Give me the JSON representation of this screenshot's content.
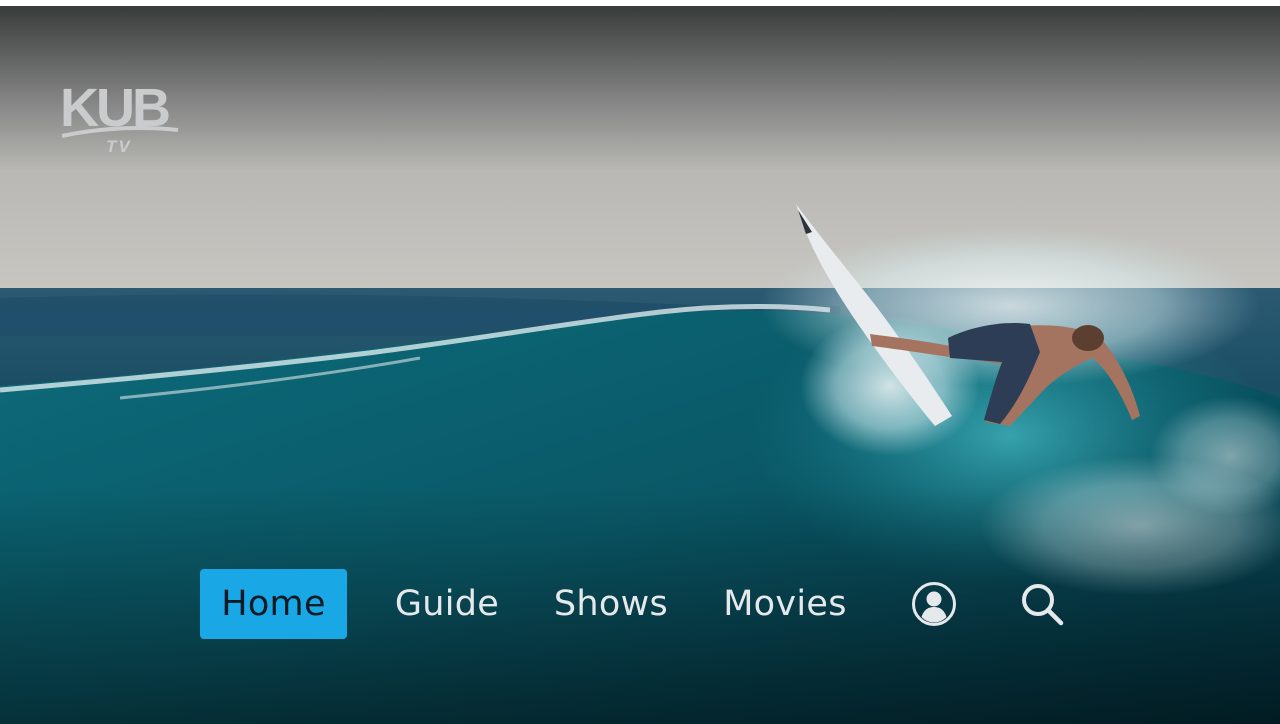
{
  "app": {
    "logo_text": "KUB",
    "logo_subtext": "TV"
  },
  "nav": {
    "items": [
      {
        "label": "Home",
        "active": true
      },
      {
        "label": "Guide",
        "active": false
      },
      {
        "label": "Shows",
        "active": false
      },
      {
        "label": "Movies",
        "active": false
      }
    ],
    "icons": [
      "profile-icon",
      "search-icon"
    ]
  },
  "colors": {
    "accent": "#1aa7e6",
    "nav_text": "#e6e9ec"
  }
}
